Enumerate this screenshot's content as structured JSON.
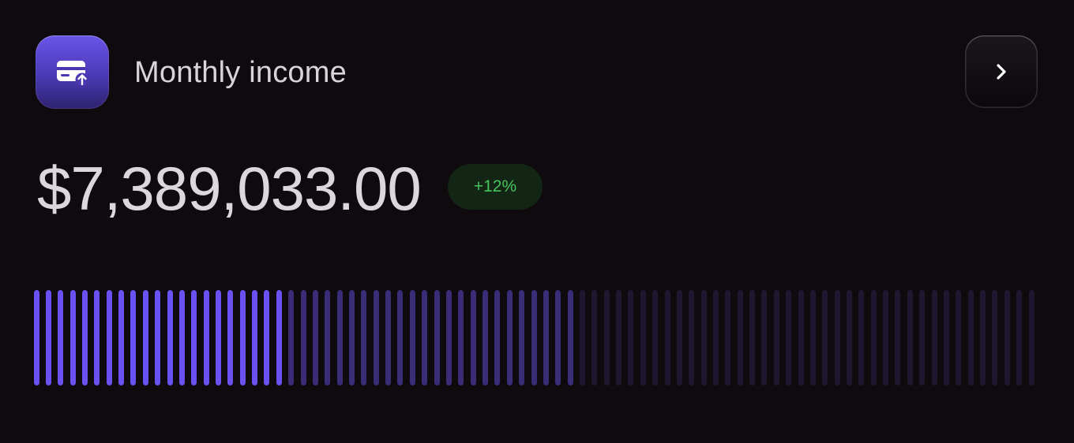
{
  "header": {
    "title": "Monthly income",
    "icon": "credit-card-upload-icon",
    "nav_icon": "chevron-right-icon"
  },
  "summary": {
    "amount": "$7,389,033.00",
    "change": "+12%",
    "change_color": "#47c45a"
  },
  "progress": {
    "total_ticks": 83,
    "filled_ticks": 21,
    "partial_ticks": 24,
    "colors": {
      "filled": "#6a52f2",
      "partial": "#3a2d78",
      "empty": "#1d1830"
    }
  }
}
